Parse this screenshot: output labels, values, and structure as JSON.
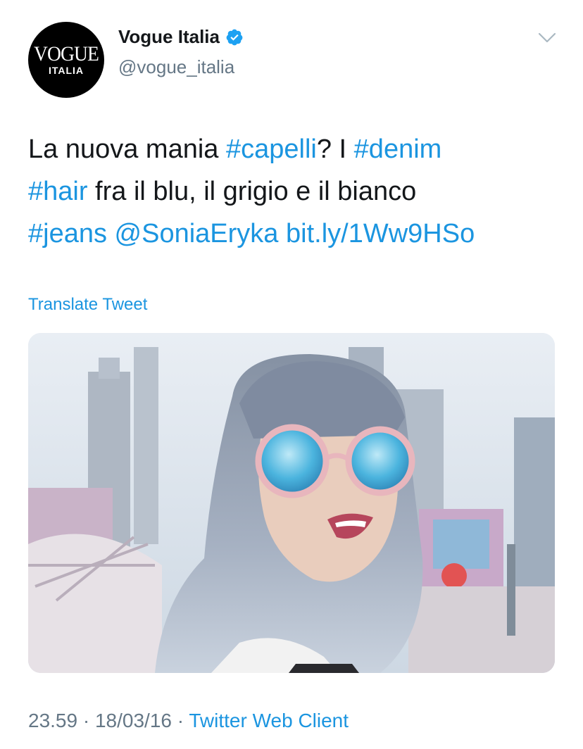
{
  "author": {
    "display_name": "Vogue Italia",
    "handle": "@vogue_italia",
    "avatar_wordmark": "VOGUE",
    "avatar_sub": "ITALIA"
  },
  "tweet": {
    "text_parts": {
      "p1": "La nuova mania ",
      "capelli": "#capelli",
      "p2": "? I ",
      "denim": "#denim",
      "hair": "#hair",
      "p3": " fra il blu, il grigio e il bianco",
      "jeans": "#jeans",
      "mention": "@SoniaEryka",
      "url": "bit.ly/1Ww9HSo"
    },
    "translate_label": "Translate Tweet"
  },
  "meta": {
    "time": "23.59",
    "date": "18/03/16",
    "separator": "·",
    "client": "Twitter Web Client"
  },
  "colors": {
    "link": "#1b95e0",
    "secondary": "#657786",
    "text": "#14171a",
    "verified": "#1da1f2"
  },
  "icons": {
    "verified": "verified-badge-icon",
    "menu": "chevron-down-icon"
  }
}
